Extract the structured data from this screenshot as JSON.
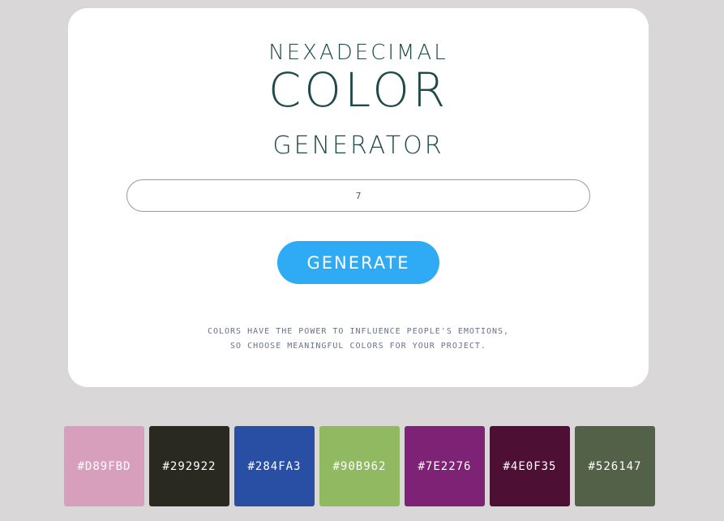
{
  "header": {
    "title_top": "NEXADECIMAL",
    "title_main": "COLOR",
    "title_bottom": "GENERATOR"
  },
  "count_input": {
    "value": "7"
  },
  "generate_button": {
    "label": "GENERATE"
  },
  "tagline": {
    "line1": "COLORS HAVE THE POWER TO INFLUENCE PEOPLE'S EMOTIONS,",
    "line2": "SO CHOOSE MEANINGFUL COLORS FOR YOUR PROJECT."
  },
  "colors": {
    "page_background": "#D9D7D8",
    "card_background": "#FFFFFF",
    "title_color": "#1F4A4A",
    "button_color": "#2FAAF5"
  },
  "swatches": [
    {
      "label": "#D89FBD",
      "color": "#D89FBD"
    },
    {
      "label": "#292922",
      "color": "#292922"
    },
    {
      "label": "#284FA3",
      "color": "#284FA3"
    },
    {
      "label": "#90B962",
      "color": "#90B962"
    },
    {
      "label": "#7E2276",
      "color": "#7E2276"
    },
    {
      "label": "#4E0F35",
      "color": "#4E0F35"
    },
    {
      "label": "#526147",
      "color": "#526147"
    }
  ]
}
